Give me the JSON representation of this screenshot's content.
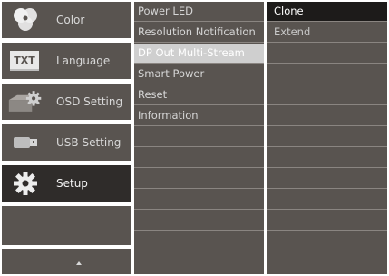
{
  "main_menu": {
    "items": [
      {
        "label": "Color",
        "icon": "color-circles-icon"
      },
      {
        "label": "Language",
        "icon": "txt-language-icon"
      },
      {
        "label": "OSD Setting",
        "icon": "osd-gear-icon"
      },
      {
        "label": "USB Setting",
        "icon": "usb-plug-icon"
      },
      {
        "label": "Setup",
        "icon": "gear-icon",
        "selected": true
      }
    ],
    "nav_icon": "up-arrow-icon"
  },
  "submenu": {
    "items": [
      {
        "label": "Power LED"
      },
      {
        "label": "Resolution Notification"
      },
      {
        "label": "DP Out Multi-Stream",
        "highlighted": true
      },
      {
        "label": "Smart Power"
      },
      {
        "label": "Reset"
      },
      {
        "label": "Information"
      },
      {
        "label": ""
      },
      {
        "label": ""
      },
      {
        "label": ""
      },
      {
        "label": ""
      },
      {
        "label": ""
      },
      {
        "label": ""
      },
      {
        "label": ""
      }
    ]
  },
  "options": {
    "items": [
      {
        "label": "Clone",
        "current": true
      },
      {
        "label": "Extend"
      },
      {
        "label": ""
      },
      {
        "label": ""
      },
      {
        "label": ""
      },
      {
        "label": ""
      },
      {
        "label": ""
      },
      {
        "label": ""
      },
      {
        "label": ""
      },
      {
        "label": ""
      },
      {
        "label": ""
      },
      {
        "label": ""
      },
      {
        "label": ""
      }
    ]
  },
  "colors": {
    "panel": "#595450",
    "selected": "#2f2c2a",
    "highlight": "#cfcfcf",
    "current": "#1d1b1a",
    "text": "#d8d8d8"
  }
}
